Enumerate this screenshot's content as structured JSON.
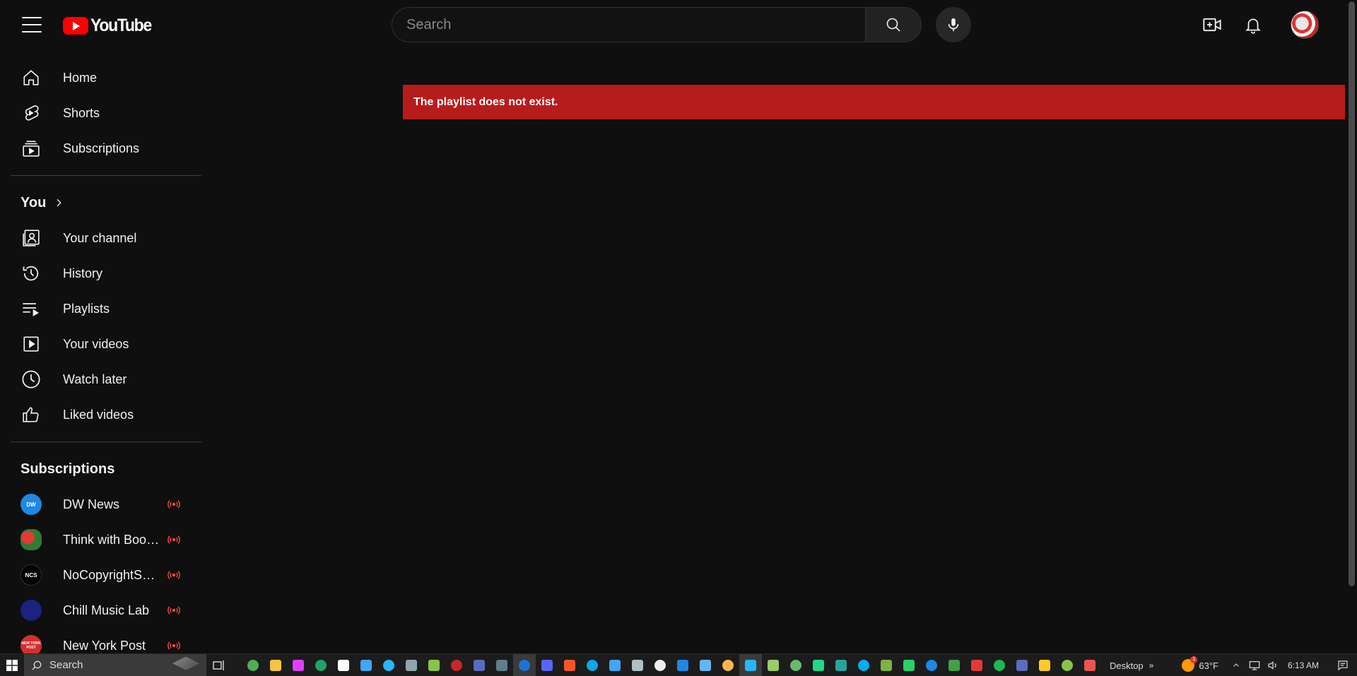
{
  "header": {
    "logo_text": "YouTube",
    "search_placeholder": "Search"
  },
  "sidebar": {
    "main_items": [
      {
        "label": "Home",
        "icon": "home-icon"
      },
      {
        "label": "Shorts",
        "icon": "shorts-icon"
      },
      {
        "label": "Subscriptions",
        "icon": "subscriptions-icon"
      }
    ],
    "you_heading": "You",
    "you_items": [
      {
        "label": "Your channel",
        "icon": "channel-icon"
      },
      {
        "label": "History",
        "icon": "history-icon"
      },
      {
        "label": "Playlists",
        "icon": "playlists-icon"
      },
      {
        "label": "Your videos",
        "icon": "video-icon"
      },
      {
        "label": "Watch later",
        "icon": "clock-icon"
      },
      {
        "label": "Liked videos",
        "icon": "thumbs-up-icon"
      }
    ],
    "subscriptions_heading": "Subscriptions",
    "subscriptions": [
      {
        "name": "DW News",
        "avatar_text": "DW",
        "color": "#1e88e5"
      },
      {
        "name": "Think with Book...",
        "avatar_text": "",
        "color": "#2e7d32"
      },
      {
        "name": "NoCopyrightSou...",
        "avatar_text": "NCS",
        "color": "#000000"
      },
      {
        "name": "Chill Music Lab",
        "avatar_text": "",
        "color": "#3949ab"
      },
      {
        "name": "New York Post",
        "avatar_text": "NEW YORK POST",
        "color": "#d32f2f"
      }
    ]
  },
  "main": {
    "error_message": "The playlist does not exist."
  },
  "colors": {
    "background": "#0f0f0f",
    "error_banner": "#b71c1c",
    "live_indicator": "#ff4e45",
    "brand_red": "#ff0000"
  },
  "taskbar": {
    "search_label": "Search",
    "desktop_label": "Desktop",
    "weather": "63°F",
    "weather_badge": "1",
    "time": "6:13 AM",
    "apps": [
      {
        "name": "chrome",
        "color": "#4caf50"
      },
      {
        "name": "file-explorer",
        "color": "#f6c343"
      },
      {
        "name": "itunes",
        "color": "#e040fb"
      },
      {
        "name": "excel",
        "color": "#21a366"
      },
      {
        "name": "tradingview",
        "color": "#ffffff"
      },
      {
        "name": "app-y",
        "color": "#42a5f5"
      },
      {
        "name": "app-z",
        "color": "#29b6f6"
      },
      {
        "name": "app-dark-circle",
        "color": "#90a4ae"
      },
      {
        "name": "chrome-alt",
        "color": "#8bc34a"
      },
      {
        "name": "app-wave",
        "color": "#c62828"
      },
      {
        "name": "media-player",
        "color": "#5c6bc0"
      },
      {
        "name": "calculator",
        "color": "#607d8b"
      },
      {
        "name": "typora",
        "color": "#1976d2"
      },
      {
        "name": "discord",
        "color": "#5865f2"
      },
      {
        "name": "brave",
        "color": "#fb542b"
      },
      {
        "name": "edge",
        "color": "#0ea5e9"
      },
      {
        "name": "remote-desktop",
        "color": "#42a5f5"
      },
      {
        "name": "app-laptop",
        "color": "#b0bec5"
      },
      {
        "name": "app-gear",
        "color": "#eeeeee"
      },
      {
        "name": "app-k",
        "color": "#1e88e5"
      },
      {
        "name": "app-screen",
        "color": "#64b5f6"
      },
      {
        "name": "app-photo",
        "color": "#ffb74d"
      },
      {
        "name": "telegram",
        "color": "#29b6f6"
      },
      {
        "name": "app-green-1",
        "color": "#9ccc65"
      },
      {
        "name": "app-green-2",
        "color": "#66bb6a"
      },
      {
        "name": "pycharm",
        "color": "#21d789"
      },
      {
        "name": "app-teal",
        "color": "#26a69a"
      },
      {
        "name": "skype",
        "color": "#00aff0"
      },
      {
        "name": "app-map",
        "color": "#7cb342"
      },
      {
        "name": "whatsapp",
        "color": "#25d366"
      },
      {
        "name": "app-blue-doc",
        "color": "#1e88e5"
      },
      {
        "name": "app-green-doc",
        "color": "#43a047"
      },
      {
        "name": "app-red-check",
        "color": "#e53935"
      },
      {
        "name": "spotify",
        "color": "#1db954"
      },
      {
        "name": "app-w",
        "color": "#5c6bc0"
      },
      {
        "name": "app-paint",
        "color": "#ffca28"
      },
      {
        "name": "app-green-3",
        "color": "#8bc34a"
      },
      {
        "name": "app-red-box",
        "color": "#ef5350"
      }
    ]
  }
}
